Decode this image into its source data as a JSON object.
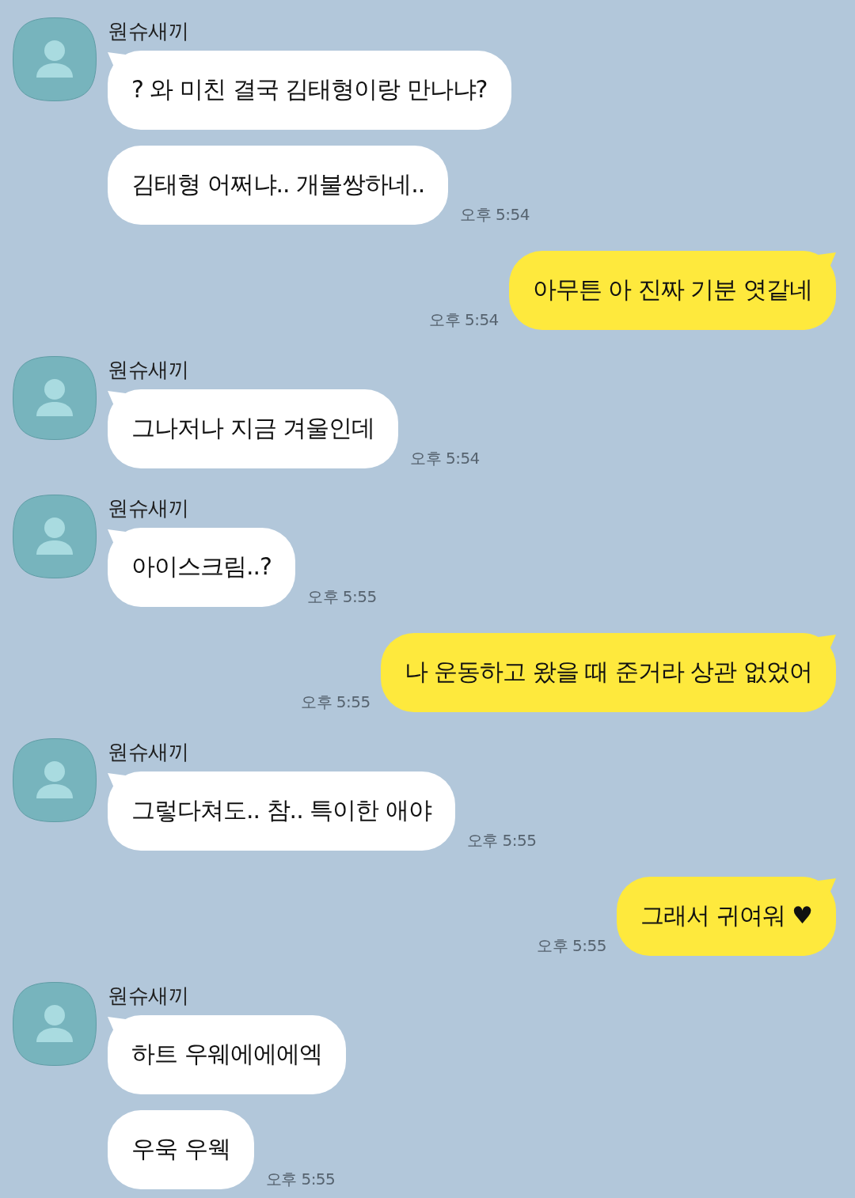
{
  "chat": {
    "groups": [
      {
        "kind": "received",
        "sender": "원슈새끼",
        "messages": [
          "? 와 미친 결국 김태형이랑 만나냐?",
          "김태형 어쩌냐.. 개불쌍하네.."
        ],
        "time": "오후 5:54"
      },
      {
        "kind": "sent",
        "messages": [
          "아무튼 아 진짜 기분 엿같네"
        ],
        "time": "오후 5:54"
      },
      {
        "kind": "received",
        "sender": "원슈새끼",
        "messages": [
          "그나저나 지금 겨울인데"
        ],
        "time": "오후 5:54"
      },
      {
        "kind": "received",
        "sender": "원슈새끼",
        "messages": [
          "아이스크림..?"
        ],
        "time": "오후 5:55"
      },
      {
        "kind": "sent",
        "messages": [
          "나 운동하고 왔을 때 준거라 상관 없었어"
        ],
        "time": "오후 5:55"
      },
      {
        "kind": "received",
        "sender": "원슈새끼",
        "messages": [
          "그렇다쳐도.. 참.. 특이한 애야"
        ],
        "time": "오후 5:55"
      },
      {
        "kind": "sent",
        "messages": [
          "그래서 귀여워 ♥"
        ],
        "time": "오후 5:55"
      },
      {
        "kind": "received",
        "sender": "원슈새끼",
        "messages": [
          "하트 우웨에에에엑",
          "우욱 우웩"
        ],
        "time": "오후 5:55"
      }
    ]
  }
}
